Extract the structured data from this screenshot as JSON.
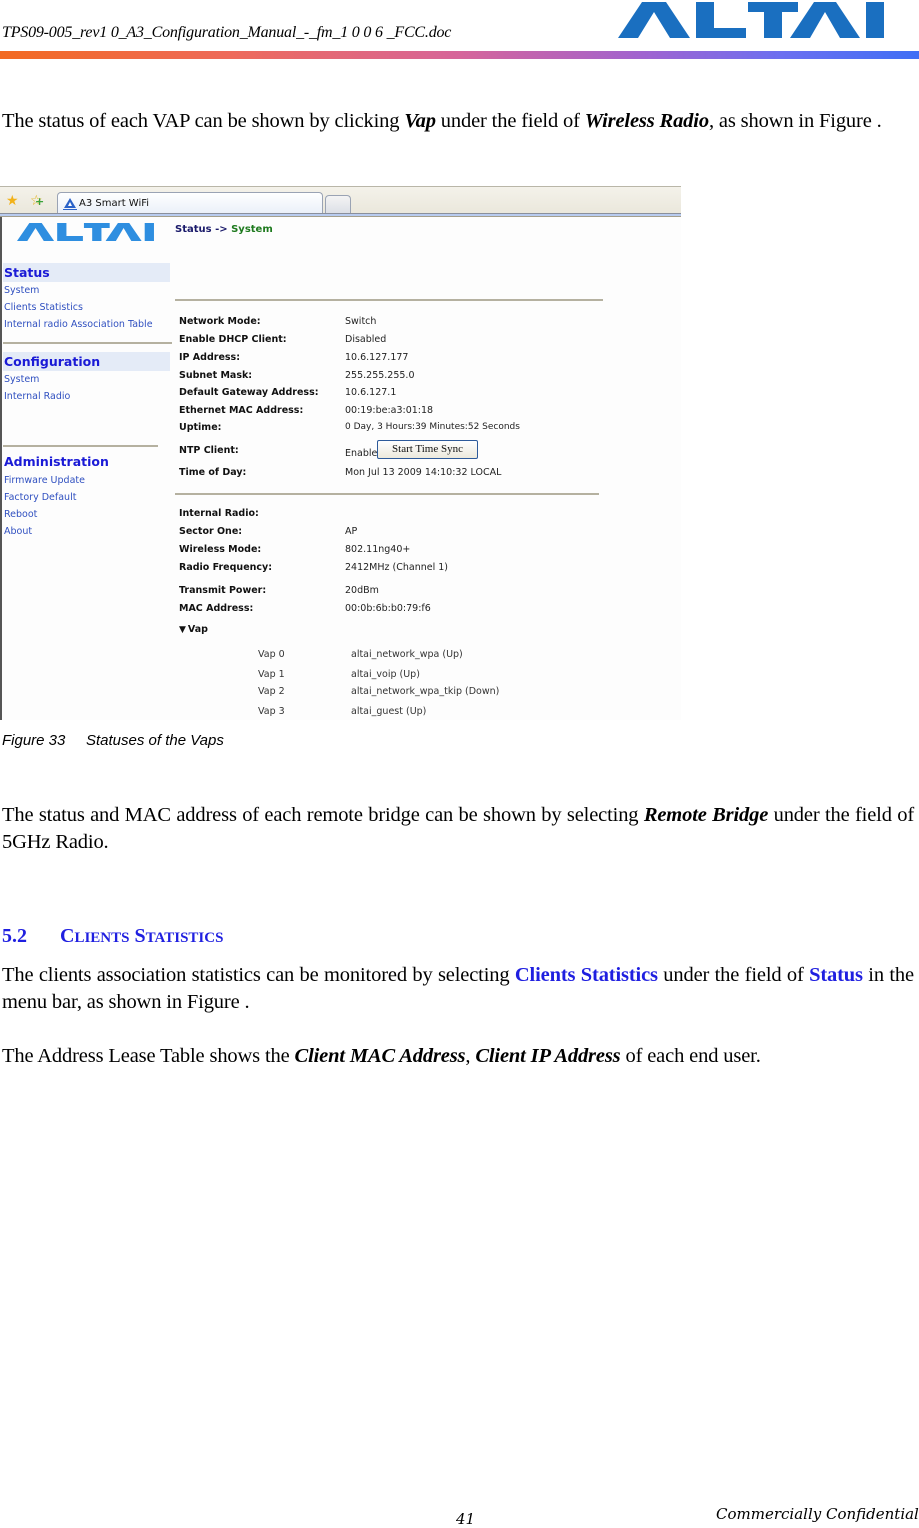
{
  "header": {
    "doc_title": "TPS09-005_rev1 0_A3_Configuration_Manual_-_fm_1 0 0 6 _FCC.doc",
    "logo_text": "ALTAI",
    "brand_color": "#1a6fc0"
  },
  "intro_paragraph": {
    "part1": "The status of each VAP can be shown by clicking ",
    "em1": "Vap",
    "part2": " under the field of ",
    "em2": "Wireless Radio",
    "part3": ", as shown in Figure ."
  },
  "figure": {
    "browser": {
      "tab_title": "A3 Smart WiFi",
      "icons": [
        "bookmark-star-icon",
        "add-bookmark-icon"
      ]
    },
    "app_logo_text": "ALTAI",
    "breadcrumb": {
      "section": "Status",
      "separator": "->",
      "page": "System"
    },
    "sidebar": {
      "groups": [
        {
          "title": "Status",
          "items": [
            "System",
            "Clients Statistics",
            "Internal radio Association Table"
          ]
        },
        {
          "title": "Configuration",
          "items": [
            "System",
            "Internal Radio"
          ]
        },
        {
          "title": "Administration",
          "items": [
            "Firmware Update",
            "Factory Default",
            "Reboot",
            "About"
          ]
        }
      ]
    },
    "system_info": [
      {
        "label": "Network Mode:",
        "value": "Switch"
      },
      {
        "label": "Enable DHCP Client:",
        "value": "Disabled"
      },
      {
        "label": "IP Address:",
        "value": "10.6.127.177"
      },
      {
        "label": "Subnet Mask:",
        "value": "255.255.255.0"
      },
      {
        "label": "Default Gateway Address:",
        "value": "10.6.127.1"
      },
      {
        "label": "Ethernet MAC Address:",
        "value": "00:19:be:a3:01:18"
      },
      {
        "label": "Uptime:",
        "value": "0 Day, 3 Hours:39 Minutes:52 Seconds"
      },
      {
        "label": "NTP Client:",
        "value": "Enable"
      },
      {
        "label": "Time of Day:",
        "value": "Mon Jul 13 2009 14:10:32 LOCAL"
      }
    ],
    "ntp_button_label": "Start Time Sync",
    "radio_info": [
      {
        "label": "Internal Radio:",
        "value": ""
      },
      {
        "label": "Sector One:",
        "value": "AP"
      },
      {
        "label": "Wireless Mode:",
        "value": "802.11ng40+"
      },
      {
        "label": "Radio Frequency:",
        "value": "2412MHz (Channel 1)"
      },
      {
        "label": "Transmit Power:",
        "value": "20dBm"
      },
      {
        "label": "MAC Address:",
        "value": "00:0b:6b:b0:79:f6"
      }
    ],
    "vap_toggle_label": "Vap",
    "vaps": [
      {
        "name": "Vap 0",
        "status": "altai_network_wpa (Up)"
      },
      {
        "name": "Vap 1",
        "status": "altai_voip (Up)"
      },
      {
        "name": "Vap 2",
        "status": "altai_network_wpa_tkip (Down)"
      },
      {
        "name": "Vap 3",
        "status": "altai_guest (Up)"
      }
    ]
  },
  "caption": {
    "number": "Figure 33",
    "text": "Statuses of the Vaps"
  },
  "remote_bridge_paragraph": {
    "part1": "The status and MAC address of each remote bridge can be shown by selecting ",
    "em1": "Remote Bridge",
    "part2": " under the field of 5GHz Radio."
  },
  "section": {
    "number": "5.2",
    "title_first": "C",
    "title_first_rest": "LIENTS",
    "title_second": "S",
    "title_second_rest": "TATISTICS"
  },
  "clients_paragraph": {
    "part1": "The clients association statistics can be monitored by selecting ",
    "link1": "Clients Statistics",
    "part2": " under the field of ",
    "link2": "Status",
    "part3": " in the menu bar, as shown in Figure ."
  },
  "lease_paragraph": {
    "part1": "The Address Lease Table shows the ",
    "em1": "Client MAC Address",
    "part2": ", ",
    "em2": "Client IP Address",
    "part3": " of each end user."
  },
  "footer": {
    "page_number": "41",
    "confidentiality": "Commercially Confidential"
  }
}
